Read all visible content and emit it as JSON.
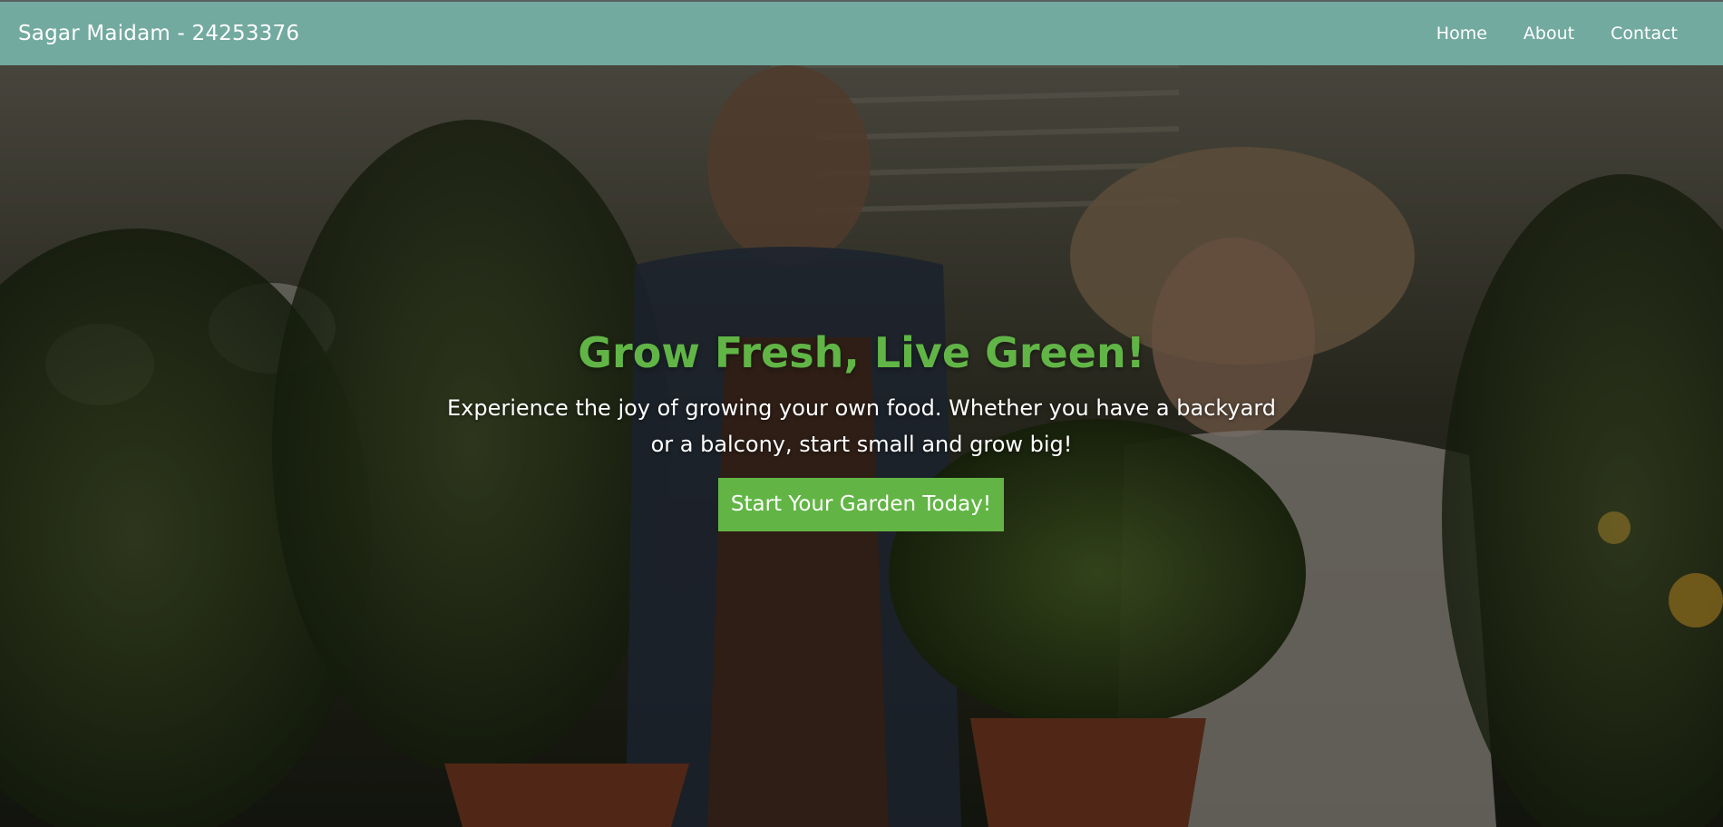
{
  "navbar": {
    "brand": "Sagar Maidam - 24253376",
    "links": [
      {
        "label": "Home"
      },
      {
        "label": "About"
      },
      {
        "label": "Contact"
      }
    ]
  },
  "hero": {
    "title": "Grow Fresh, Live Green!",
    "text": "Experience the joy of growing your own food. Whether you have a backyard or a balcony, start small and grow big!",
    "cta_label": "Start Your Garden Today!",
    "background_image": "greenhouse-couple-holding-potted-plants"
  },
  "colors": {
    "navbar": "#73aaa0",
    "title": "#61b546",
    "button": "#62b545"
  }
}
